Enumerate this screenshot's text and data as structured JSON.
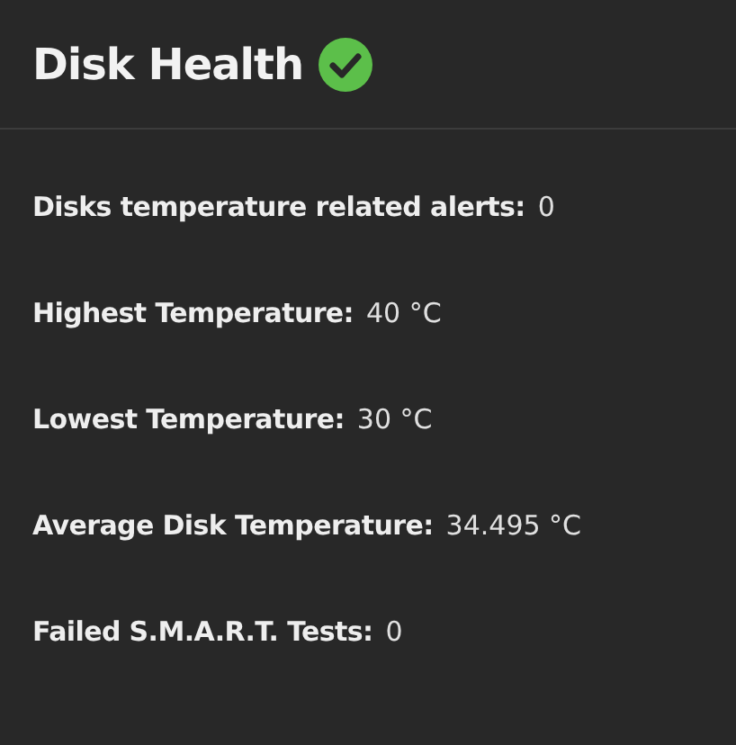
{
  "card": {
    "title": "Disk Health",
    "healthy": true,
    "stats": [
      {
        "label": "Disks temperature related alerts:",
        "value": "0"
      },
      {
        "label": "Highest Temperature:",
        "value": "40 °C"
      },
      {
        "label": "Lowest Temperature:",
        "value": "30 °C"
      },
      {
        "label": "Average Disk Temperature:",
        "value": "34.495 °C"
      },
      {
        "label": "Failed S.M.A.R.T. Tests:",
        "value": "0"
      }
    ]
  }
}
